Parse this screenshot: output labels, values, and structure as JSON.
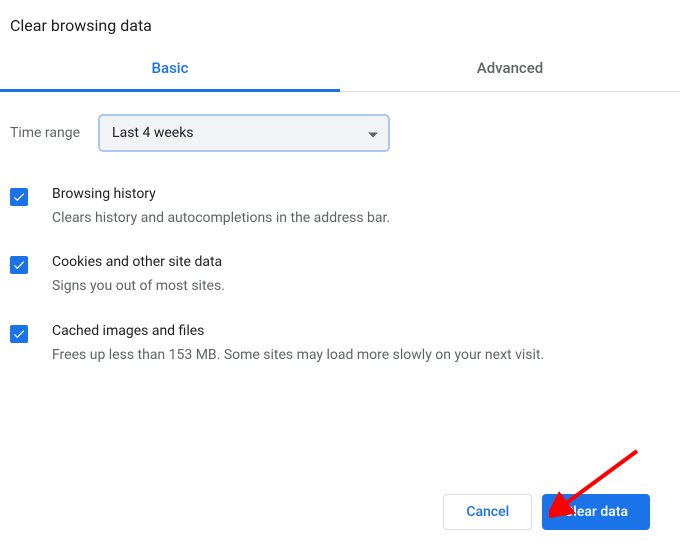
{
  "dialog": {
    "title": "Clear browsing data"
  },
  "tabs": {
    "basic": "Basic",
    "advanced": "Advanced"
  },
  "time_range": {
    "label": "Time range",
    "selected": "Last 4 weeks"
  },
  "options": [
    {
      "title": "Browsing history",
      "desc": "Clears history and autocompletions in the address bar.",
      "checked": true
    },
    {
      "title": "Cookies and other site data",
      "desc": "Signs you out of most sites.",
      "checked": true
    },
    {
      "title": "Cached images and files",
      "desc": "Frees up less than 153 MB. Some sites may load more slowly on your next visit.",
      "checked": true
    }
  ],
  "buttons": {
    "cancel": "Cancel",
    "clear": "Clear data"
  },
  "colors": {
    "accent": "#1a73e8",
    "arrow": "#ff0000"
  }
}
